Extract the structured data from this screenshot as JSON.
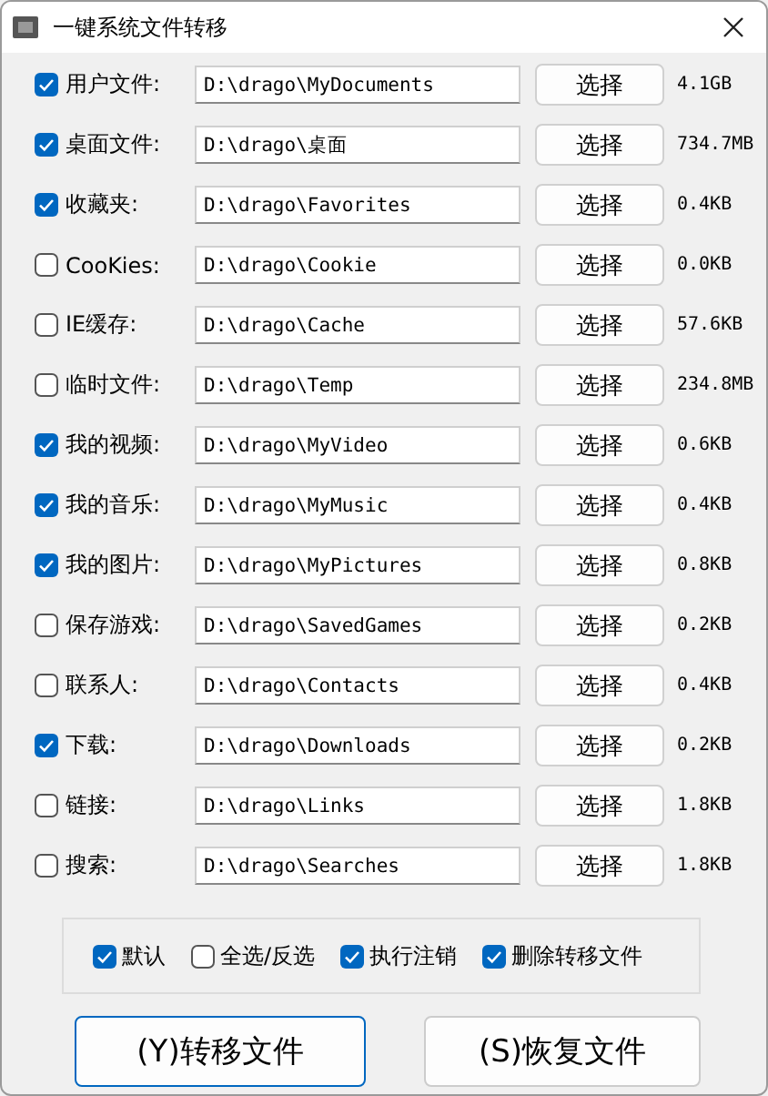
{
  "window": {
    "title": "一键系统文件转移"
  },
  "folders": [
    {
      "label": "用户文件:",
      "checked": true,
      "path": "D:\\drago\\MyDocuments",
      "button": "选择",
      "size": "4.1GB"
    },
    {
      "label": "桌面文件:",
      "checked": true,
      "path": "D:\\drago\\桌面",
      "button": "选择",
      "size": "734.7MB"
    },
    {
      "label": "收藏夹:",
      "checked": true,
      "path": "D:\\drago\\Favorites",
      "button": "选择",
      "size": "0.4KB"
    },
    {
      "label": "CooKies:",
      "checked": false,
      "path": "D:\\drago\\Cookie",
      "button": "选择",
      "size": "0.0KB"
    },
    {
      "label": "IE缓存:",
      "checked": false,
      "path": "D:\\drago\\Cache",
      "button": "选择",
      "size": "57.6KB"
    },
    {
      "label": "临时文件:",
      "checked": false,
      "path": "D:\\drago\\Temp",
      "button": "选择",
      "size": "234.8MB"
    },
    {
      "label": "我的视频:",
      "checked": true,
      "path": "D:\\drago\\MyVideo",
      "button": "选择",
      "size": "0.6KB"
    },
    {
      "label": "我的音乐:",
      "checked": true,
      "path": "D:\\drago\\MyMusic",
      "button": "选择",
      "size": "0.4KB"
    },
    {
      "label": "我的图片:",
      "checked": true,
      "path": "D:\\drago\\MyPictures",
      "button": "选择",
      "size": "0.8KB"
    },
    {
      "label": "保存游戏:",
      "checked": false,
      "path": "D:\\drago\\SavedGames",
      "button": "选择",
      "size": "0.2KB"
    },
    {
      "label": "联系人:",
      "checked": false,
      "path": "D:\\drago\\Contacts",
      "button": "选择",
      "size": "0.4KB"
    },
    {
      "label": "下载:",
      "checked": true,
      "path": "D:\\drago\\Downloads",
      "button": "选择",
      "size": "0.2KB"
    },
    {
      "label": "链接:",
      "checked": false,
      "path": "D:\\drago\\Links",
      "button": "选择",
      "size": "1.8KB"
    },
    {
      "label": "搜索:",
      "checked": false,
      "path": "D:\\drago\\Searches",
      "button": "选择",
      "size": "1.8KB"
    }
  ],
  "options": [
    {
      "label": "默认",
      "checked": true
    },
    {
      "label": "全选/反选",
      "checked": false
    },
    {
      "label": "执行注销",
      "checked": true
    },
    {
      "label": "删除转移文件",
      "checked": true
    }
  ],
  "buttons": [
    {
      "label": "(Y)转移文件",
      "focused": true
    },
    {
      "label": "(S)恢复文件",
      "focused": false
    }
  ]
}
